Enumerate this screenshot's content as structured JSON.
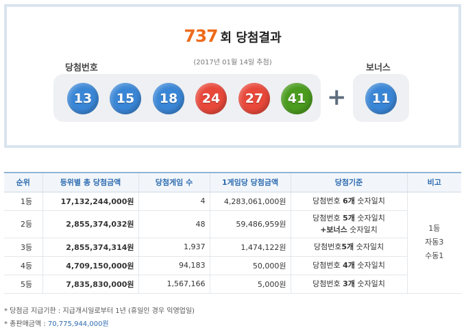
{
  "header": {
    "round_number": "737",
    "round_suffix": "회 당첨결과",
    "draw_date": "(2017년 01월 14일 추첨)",
    "winning_label": "당첨번호",
    "bonus_label": "보너스"
  },
  "balls": [
    {
      "number": "13",
      "color": "#3a86d6"
    },
    {
      "number": "15",
      "color": "#3a86d6"
    },
    {
      "number": "18",
      "color": "#3a86d6"
    },
    {
      "number": "24",
      "color": "#e8483a"
    },
    {
      "number": "27",
      "color": "#e8483a"
    },
    {
      "number": "41",
      "color": "#4a9b1e"
    }
  ],
  "plus_symbol": "+",
  "bonus_ball": {
    "number": "11",
    "color": "#3a86d6"
  },
  "table": {
    "headers": [
      "순위",
      "등위별 총 당첨금액",
      "당첨게임 수",
      "1게임당 당첨금액",
      "당첨기준",
      "비고"
    ],
    "rows": [
      {
        "rank": "1등",
        "total": "17,132,244,000원",
        "games": "4",
        "per_game": "4,283,061,000원",
        "crit_pre": "당첨번호 ",
        "crit_bold": "6개",
        "crit_post": " 숫자일치",
        "crit_line2": ""
      },
      {
        "rank": "2등",
        "total": "2,855,374,032원",
        "games": "48",
        "per_game": "59,486,959원",
        "crit_pre": "당첨번호 ",
        "crit_bold": "5개",
        "crit_post": " 숫자일치",
        "crit_line2_bold": "+보너스",
        "crit_line2": " 숫자일치"
      },
      {
        "rank": "3등",
        "total": "2,855,374,314원",
        "games": "1,937",
        "per_game": "1,474,122원",
        "crit_pre": "당첨번호",
        "crit_bold": "5개",
        "crit_post": " 숫자일치",
        "crit_line2": ""
      },
      {
        "rank": "4등",
        "total": "4,709,150,000원",
        "games": "94,183",
        "per_game": "50,000원",
        "crit_pre": "당첨번호 ",
        "crit_bold": "4개",
        "crit_post": " 숫자일치",
        "crit_line2": ""
      },
      {
        "rank": "5등",
        "total": "7,835,830,000원",
        "games": "1,567,166",
        "per_game": "5,000원",
        "crit_pre": "당첨번호 ",
        "crit_bold": "3개",
        "crit_post": " 숫자일치",
        "crit_line2": ""
      }
    ],
    "note_lines": [
      "1등",
      "자동3",
      "수동1"
    ]
  },
  "notes": {
    "deadline": "* 당첨금 지급기한 : 지급개시일로부터 1년 (휴일인 경우 익영업일)",
    "sales_label": "* 총판매금액 : ",
    "sales_amount": "70,775,944,000원"
  }
}
